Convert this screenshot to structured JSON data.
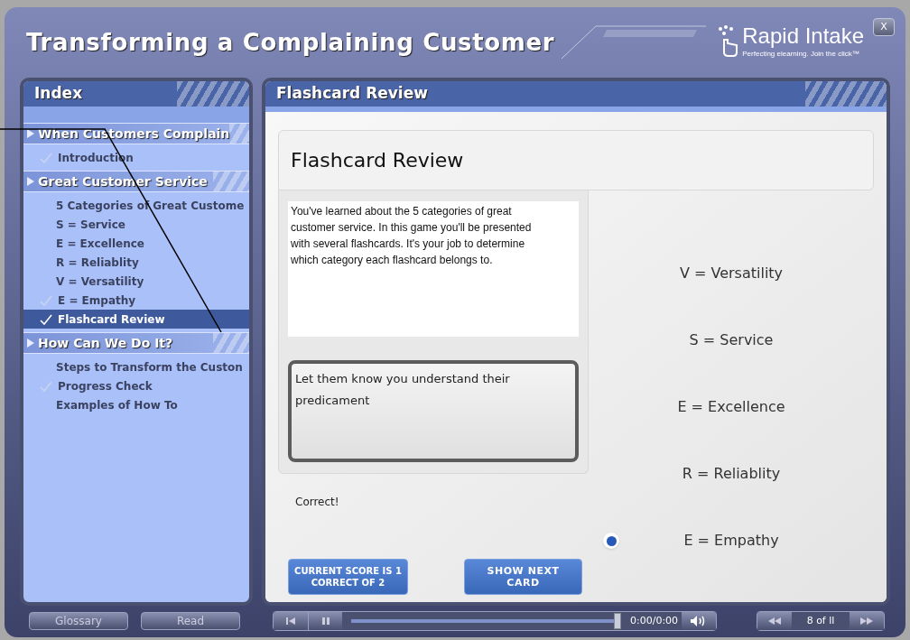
{
  "window": {
    "title": "Transforming a Complaining Customer",
    "close": "X"
  },
  "brand": {
    "name": "Rapid Intake",
    "tagline": "Perfecting elearning.  Join the click™"
  },
  "index": {
    "title": "Index",
    "sections": [
      {
        "title": "When Customers Complain",
        "items": [
          {
            "label": "Introduction",
            "checked": true,
            "selected": false
          }
        ]
      },
      {
        "title": "Great Customer Service",
        "items": [
          {
            "label": "5 Categories of Great Custome",
            "checked": false,
            "selected": false
          },
          {
            "label": "S = Service",
            "checked": false,
            "selected": false
          },
          {
            "label": "E = Excellence",
            "checked": false,
            "selected": false
          },
          {
            "label": "R = Reliablity",
            "checked": false,
            "selected": false
          },
          {
            "label": "V = Versatility",
            "checked": false,
            "selected": false
          },
          {
            "label": "E = Empathy",
            "checked": true,
            "selected": false
          },
          {
            "label": "Flashcard Review",
            "checked": true,
            "selected": true
          }
        ]
      },
      {
        "title": "How Can We Do It?",
        "items": [
          {
            "label": "Steps to Transform the Custon",
            "checked": false,
            "selected": false
          },
          {
            "label": "Progress Check",
            "checked": true,
            "selected": false
          },
          {
            "label": "Examples of How To",
            "checked": false,
            "selected": false
          }
        ]
      }
    ]
  },
  "content": {
    "header": "Flashcard Review",
    "heading": "Flashcard Review",
    "intro": "You've learned about the 5 categories of great customer service. In this game you'll be presented with several flashcards. It's your job to determine which category each flashcard belongs to.",
    "card": "Let them know you understand their predicament",
    "feedback": "Correct!",
    "score_button": [
      "CURRENT SCORE IS 1",
      "CORRECT OF 2"
    ],
    "next_button": [
      "SHOW NEXT",
      "CARD"
    ],
    "options": [
      {
        "label": "V = Versatility",
        "selected": false
      },
      {
        "label": "S = Service",
        "selected": false
      },
      {
        "label": "E = Excellence",
        "selected": false
      },
      {
        "label": "R = Reliablity",
        "selected": false
      },
      {
        "label": "E = Empathy",
        "selected": true
      }
    ]
  },
  "footer": {
    "glossary": "Glossary",
    "read": "Read",
    "progress": {
      "level": 1
    },
    "time": "0:00/0:00",
    "page": "8 of ll"
  }
}
